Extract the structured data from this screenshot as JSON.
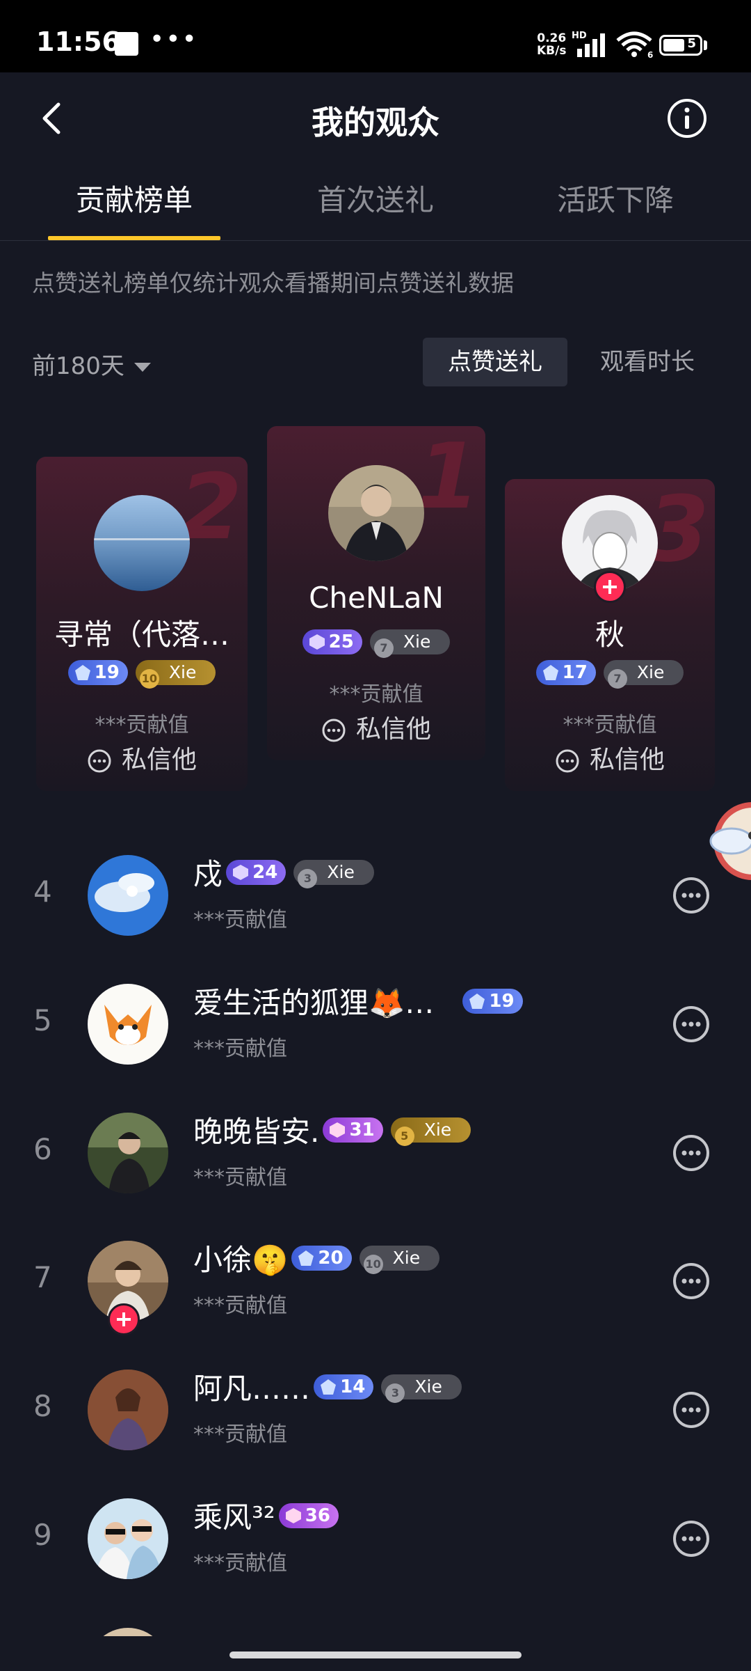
{
  "status_bar": {
    "time": "11:56",
    "net_speed_value": "0.26",
    "net_speed_unit": "KB/s",
    "hd": "HD",
    "wifi_sub": "6",
    "battery": "5"
  },
  "header": {
    "title": "我的观众"
  },
  "tabs": [
    {
      "label": "贡献榜单",
      "active": true
    },
    {
      "label": "首次送礼",
      "active": false
    },
    {
      "label": "活跃下降",
      "active": false
    }
  ],
  "notice": "点赞送礼榜单仅统计观众看播期间点赞送礼数据",
  "filter": {
    "period": "前180天",
    "toggle_like": "点赞送礼",
    "toggle_watch": "观看时长"
  },
  "podium": [
    {
      "rank": "2",
      "name": "寻常（代落…",
      "level": "19",
      "fan_level": "10",
      "fan_label": "Xie",
      "contrib": "***贡献值",
      "dm": "私信他"
    },
    {
      "rank": "1",
      "name": "CheNLaN",
      "level": "25",
      "fan_level": "7",
      "fan_label": "Xie",
      "contrib": "***贡献值",
      "dm": "私信他"
    },
    {
      "rank": "3",
      "name": "秋",
      "level": "17",
      "fan_level": "7",
      "fan_label": "Xie",
      "contrib": "***贡献值",
      "dm": "私信他"
    }
  ],
  "list": [
    {
      "rank": "4",
      "name": "戍",
      "level": "24",
      "fan_level": "3",
      "fan_label": "Xie",
      "contrib": "***贡献值"
    },
    {
      "rank": "5",
      "name": "爱生活的狐狸🦊…",
      "level": "19",
      "contrib": "***贡献值"
    },
    {
      "rank": "6",
      "name": "晚晚皆安.",
      "level": "31",
      "fan_level": "5",
      "fan_label": "Xie",
      "contrib": "***贡献值"
    },
    {
      "rank": "7",
      "name": "小徐🤫",
      "level": "20",
      "fan_level": "10",
      "fan_label": "Xie",
      "contrib": "***贡献值"
    },
    {
      "rank": "8",
      "name": "阿凡……",
      "level": "14",
      "fan_level": "3",
      "fan_label": "Xie",
      "contrib": "***贡献值"
    },
    {
      "rank": "9",
      "name": "乘风³²",
      "level": "36",
      "contrib": "***贡献值"
    }
  ],
  "colors": {
    "background": "#161823",
    "accent_underline": "#fdc62a",
    "follow": "#fe2c55"
  }
}
